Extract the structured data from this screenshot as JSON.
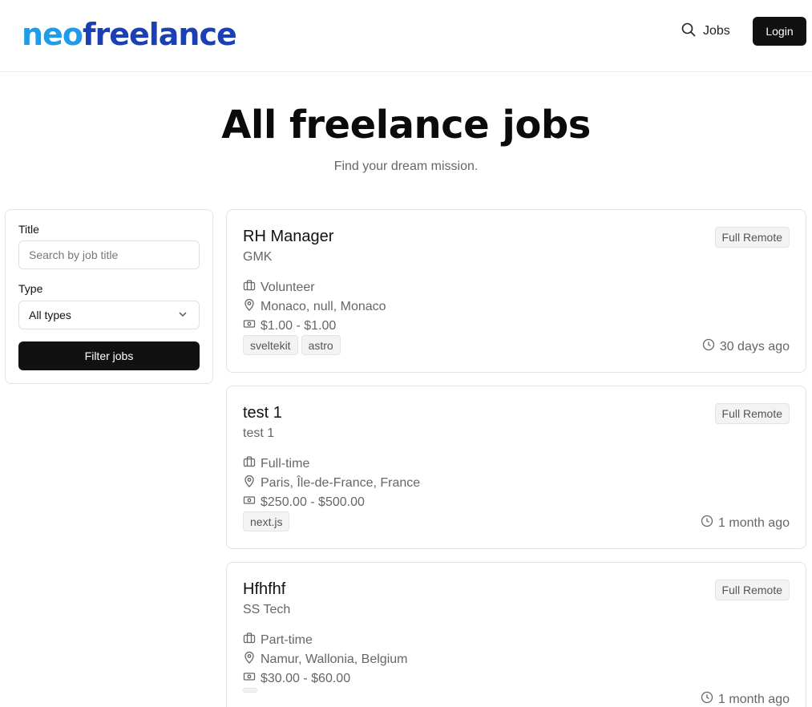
{
  "header": {
    "logo_part1": "neo",
    "logo_part2": "freelance",
    "nav_jobs": "Jobs",
    "login": "Login"
  },
  "hero": {
    "title": "All freelance jobs",
    "subtitle": "Find your dream mission."
  },
  "filters": {
    "title_label": "Title",
    "title_placeholder": "Search by job title",
    "title_value": "",
    "type_label": "Type",
    "type_value": "All types",
    "submit": "Filter jobs"
  },
  "jobs": [
    {
      "title": "RH Manager",
      "company": "GMK",
      "badge": "Full Remote",
      "type": "Volunteer",
      "location": "Monaco, null, Monaco",
      "salary": "$1.00 - $1.00",
      "tags": [
        "sveltekit",
        "astro"
      ],
      "posted": "30 days ago"
    },
    {
      "title": "test 1",
      "company": "test 1",
      "badge": "Full Remote",
      "type": "Full-time",
      "location": "Paris, Île-de-France, France",
      "salary": "$250.00 - $500.00",
      "tags": [
        "next.js"
      ],
      "posted": "1 month ago"
    },
    {
      "title": "Hfhfhf",
      "company": "SS Tech",
      "badge": "Full Remote",
      "type": "Part-time",
      "location": "Namur, Wallonia, Belgium",
      "salary": "$30.00 - $60.00",
      "tags": [
        ""
      ],
      "posted": "1 month ago"
    }
  ],
  "colors": {
    "logo_light": "#1e9be9",
    "logo_dark": "#1b3fb5",
    "primary_button": "#111111"
  },
  "icons": {
    "search": "search-icon",
    "briefcase": "briefcase-icon",
    "location": "map-pin-icon",
    "salary": "banknote-icon",
    "clock": "clock-icon",
    "chevron": "chevron-down-icon"
  }
}
